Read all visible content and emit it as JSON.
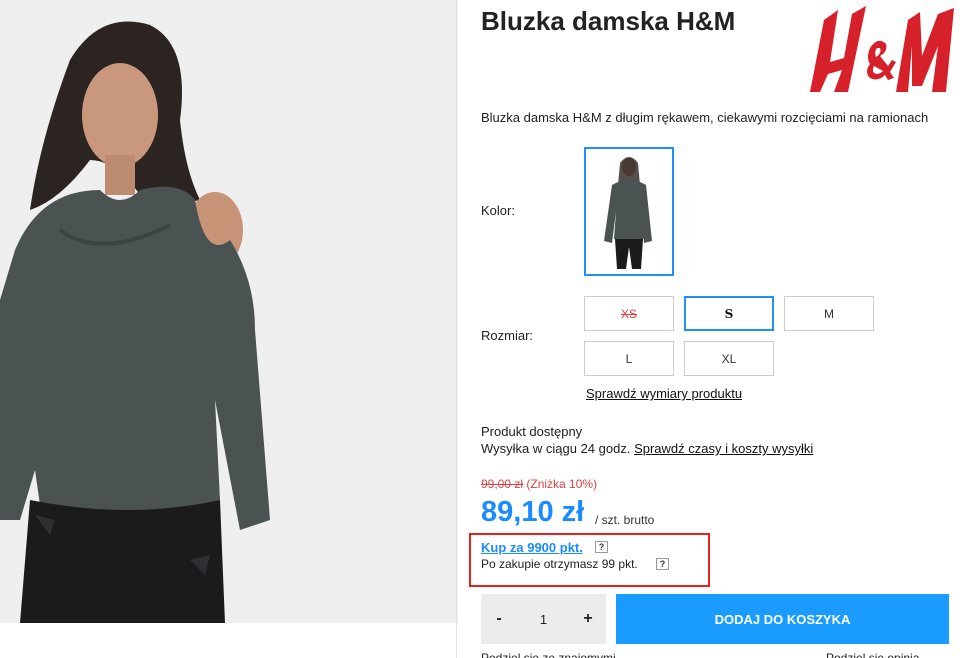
{
  "product": {
    "title": "Bluzka damska H&M",
    "brand_logo_text": "H&M",
    "description": "Bluzka damska H&M z długim rękawem, ciekawymi rozcięciami na ramionach"
  },
  "color": {
    "label": "Kolor:"
  },
  "size": {
    "label": "Rozmiar:",
    "options": [
      {
        "label": "XS",
        "state": "unavailable"
      },
      {
        "label": "S",
        "state": "selected"
      },
      {
        "label": "M",
        "state": "available"
      },
      {
        "label": "L",
        "state": "available"
      },
      {
        "label": "XL",
        "state": "available"
      }
    ],
    "dimensions_link": "Sprawdź wymiary produktu"
  },
  "availability": {
    "status": "Produkt dostępny",
    "shipping": "Wysyłka w ciągu 24 godz.",
    "shipping_link": "Sprawdź czasy i koszty wysyłki"
  },
  "pricing": {
    "old_price": "99,00 zł",
    "discount": "(Zniżka 10%)",
    "price": "89,10 zł",
    "unit": "/ szt. brutto"
  },
  "points": {
    "buy_link": "Kup za 9900 pkt.",
    "earn_text": "Po zakupie otrzymasz 99 pkt.",
    "help_mark": "?"
  },
  "cart": {
    "minus": "-",
    "plus": "+",
    "quantity": "1",
    "add_label": "DODAJ DO KOSZYKA"
  },
  "footer_cut": {
    "left": "Podziel się ze znajomymi",
    "right": "Podziel się opinią"
  },
  "colors": {
    "accent": "#1a8cff",
    "button": "#1a9bff",
    "sale": "#e04040",
    "highlight_box": "#e5201f",
    "logo_red": "#d6202a"
  }
}
